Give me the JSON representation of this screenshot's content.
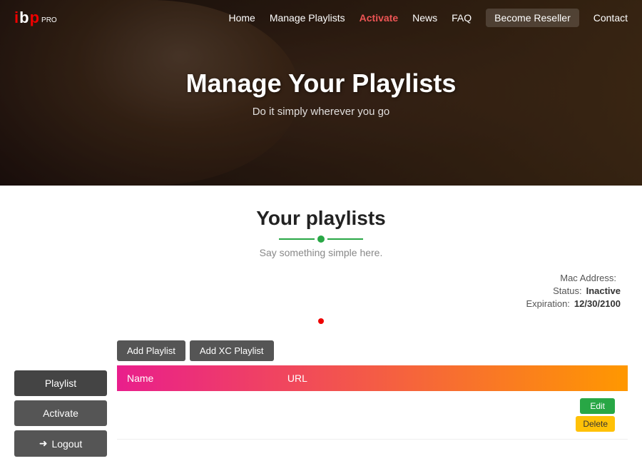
{
  "nav": {
    "logo": {
      "ibp": "ibp",
      "pro": "PRO"
    },
    "links": [
      {
        "label": "Home",
        "active": false
      },
      {
        "label": "Manage Playlists",
        "active": false
      },
      {
        "label": "Activate",
        "active": true
      },
      {
        "label": "News",
        "active": false
      },
      {
        "label": "FAQ",
        "active": false
      },
      {
        "label": "Become Reseller",
        "active": false
      },
      {
        "label": "Contact",
        "active": false
      }
    ]
  },
  "hero": {
    "title": "Manage Your Playlists",
    "subtitle": "Do it simply wherever you go"
  },
  "section": {
    "title": "Your playlists",
    "subtitle": "Say something simple here."
  },
  "info": {
    "mac_label": "Mac Address:",
    "mac_value": "",
    "status_label": "Status:",
    "status_value": "Inactive",
    "expiration_label": "Expiration:",
    "expiration_value": "12/30/2100"
  },
  "sidebar": {
    "playlist_label": "Playlist",
    "activate_label": "Activate",
    "logout_label": "Logout",
    "logout_icon": "➜"
  },
  "toolbar": {
    "add_playlist_label": "Add Playlist",
    "add_xc_playlist_label": "Add XC Playlist"
  },
  "table": {
    "columns": [
      {
        "label": "Name"
      },
      {
        "label": "URL"
      }
    ],
    "rows": [
      {
        "name": "",
        "url": ""
      }
    ]
  },
  "row_actions": {
    "edit_label": "Edit",
    "delete_label": "Delete"
  }
}
